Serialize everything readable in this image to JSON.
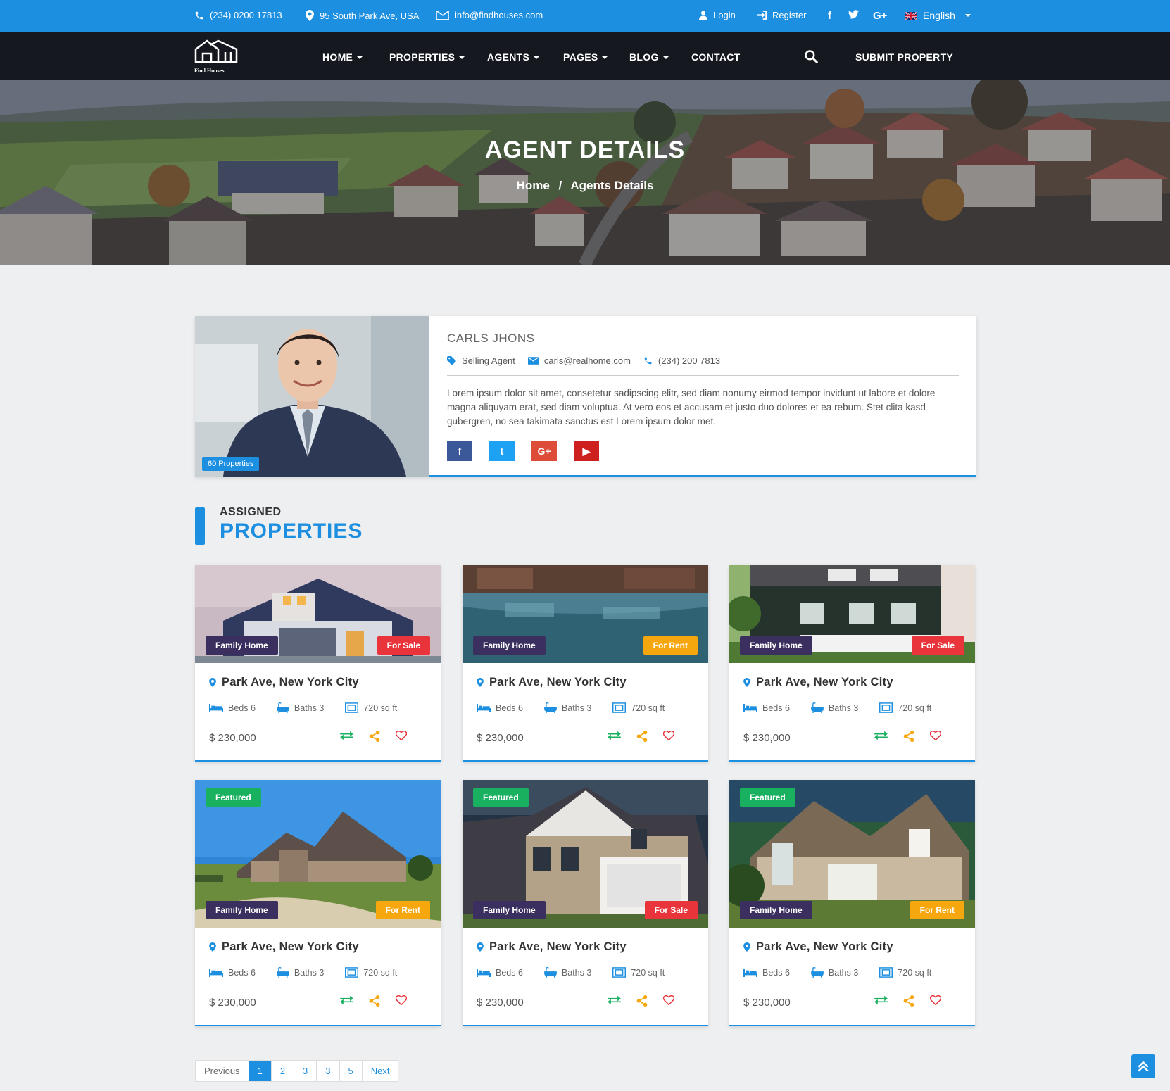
{
  "topbar": {
    "phone": "(234) 0200 17813",
    "address": "95 South Park Ave, USA",
    "email": "info@findhouses.com",
    "login": "Login",
    "register": "Register",
    "gplus": "G+",
    "language": "English"
  },
  "nav": {
    "logo_text": "Find Houses",
    "items": [
      "HOME",
      "PROPERTIES",
      "AGENTS",
      "PAGES",
      "BLOG",
      "CONTACT"
    ],
    "submit": "SUBMIT PROPERTY"
  },
  "hero": {
    "title": "AGENT DETAILS",
    "crumb_home": "Home",
    "crumb_sep": "/",
    "crumb_current": "Agents Details"
  },
  "agent": {
    "name": "CARLS JHONS",
    "properties_badge": "60 Properties",
    "role": "Selling Agent",
    "email": "carls@realhome.com",
    "phone": "(234) 200 7813",
    "bio": "Lorem ipsum dolor sit amet, consetetur sadipscing elitr, sed diam nonumy eirmod tempor invidunt ut labore et dolore magna aliquyam erat, sed diam voluptua. At vero eos et accusam et justo duo dolores et ea rebum. Stet clita kasd gubergren, no sea takimata sanctus est Lorem ipsum dolor met.",
    "socials": [
      {
        "name": "facebook",
        "glyph": "f",
        "color": "#3b5998"
      },
      {
        "name": "twitter",
        "glyph": "t",
        "color": "#1da1f2"
      },
      {
        "name": "google-plus",
        "glyph": "G+",
        "color": "#dd4b39"
      },
      {
        "name": "youtube",
        "glyph": "▶",
        "color": "#cd201f"
      }
    ]
  },
  "section": {
    "top": "ASSIGNED",
    "main": "PROPERTIES"
  },
  "properties": [
    {
      "type": "Family Home",
      "status": "For Sale",
      "status_color": "#e8343a",
      "featured": "",
      "title": "Park Ave, New York City",
      "beds": "Beds 6",
      "baths": "Baths 3",
      "area": "720 sq ft",
      "price": "$ 230,000"
    },
    {
      "type": "Family Home",
      "status": "For Rent",
      "status_color": "#f5a70d",
      "featured": "",
      "title": "Park Ave, New York City",
      "beds": "Beds 6",
      "baths": "Baths 3",
      "area": "720 sq ft",
      "price": "$ 230,000"
    },
    {
      "type": "Family Home",
      "status": "For Sale",
      "status_color": "#e8343a",
      "featured": "",
      "title": "Park Ave, New York City",
      "beds": "Beds 6",
      "baths": "Baths 3",
      "area": "720 sq ft",
      "price": "$ 230,000"
    },
    {
      "type": "Family Home",
      "status": "For Rent",
      "status_color": "#f5a70d",
      "featured": "Featured",
      "title": "Park Ave, New York City",
      "beds": "Beds 6",
      "baths": "Baths 3",
      "area": "720 sq ft",
      "price": "$ 230,000"
    },
    {
      "type": "Family Home",
      "status": "For Sale",
      "status_color": "#e8343a",
      "featured": "Featured",
      "title": "Park Ave, New York City",
      "beds": "Beds 6",
      "baths": "Baths 3",
      "area": "720 sq ft",
      "price": "$ 230,000"
    },
    {
      "type": "Family Home",
      "status": "For Rent",
      "status_color": "#f5a70d",
      "featured": "Featured",
      "title": "Park Ave, New York City",
      "beds": "Beds 6",
      "baths": "Baths 3",
      "area": "720 sq ft",
      "price": "$ 230,000"
    }
  ],
  "pagination": {
    "previous": "Previous",
    "pages": [
      "1",
      "2",
      "3",
      "3",
      "5"
    ],
    "active": "1",
    "next": "Next"
  },
  "colors": {
    "accent": "#1d8fe0",
    "nav_bg": "#15191f",
    "tag_purple": "#3a2f5e",
    "featured_green": "#19b160",
    "sale_red": "#e8343a",
    "rent_orange": "#f5a70d"
  }
}
